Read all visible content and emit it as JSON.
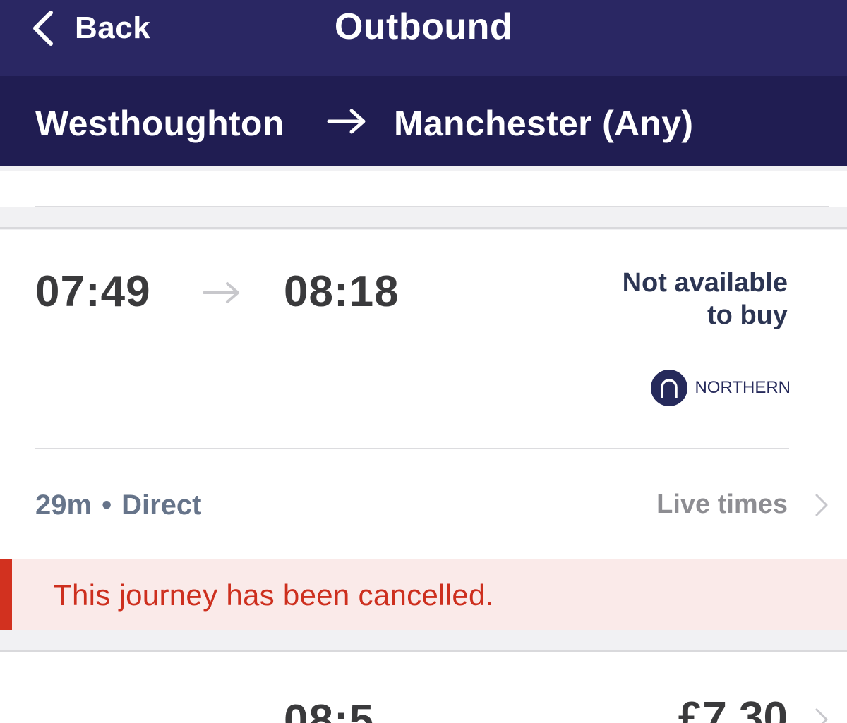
{
  "nav": {
    "back_label": "Back",
    "title": "Outbound"
  },
  "route": {
    "from": "Westhoughton",
    "to": "Manchester (Any)"
  },
  "journey": {
    "departure": "07:49",
    "arrival": "08:18",
    "availability_line1": "Not available",
    "availability_line2": "to buy",
    "operator": "NORTHERN",
    "duration": "29m",
    "separator": "•",
    "changes": "Direct",
    "live_times_label": "Live times",
    "cancel_message": "This journey has been cancelled."
  },
  "next_journey": {
    "arrival_partial": "08:5",
    "price_partial": "£7.30"
  },
  "colors": {
    "nav_bg": "#2a2763",
    "route_bg": "#201d52",
    "cancel_red": "#d2311f",
    "cancel_bg": "#faeae9",
    "operator_navy": "#262a5b"
  },
  "icons": {
    "back": "chevron-left-icon",
    "route_arrow": "arrow-right-icon",
    "time_arrow": "arrow-right-icon",
    "operator": "northern-logo-icon",
    "live_times": "chevron-right-icon"
  }
}
